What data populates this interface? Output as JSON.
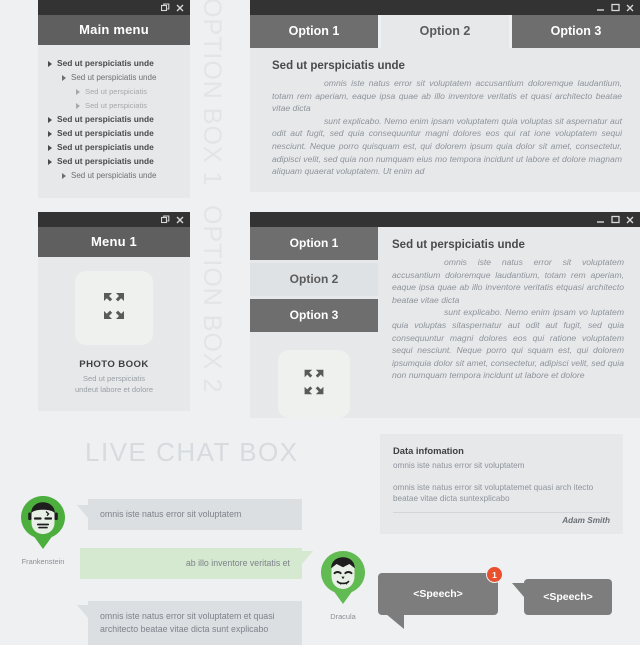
{
  "watermarks": {
    "option_box_1": "OPTION BOX 1",
    "option_box_2": "OPTION BOX 2"
  },
  "main_menu_window": {
    "title": "Main menu",
    "controls": {
      "restore": "restore-icon",
      "close": "close-icon"
    },
    "tree_items": [
      {
        "label": "Sed ut perspiciatis unde",
        "level": 0
      },
      {
        "label": "Sed ut perspiciatis unde",
        "level": 1
      },
      {
        "label": "Sed ut perspiciatis",
        "level": 2
      },
      {
        "label": "Sed ut perspiciatis",
        "level": 2
      },
      {
        "label": "Sed ut perspiciatis unde",
        "level": 0
      },
      {
        "label": "Sed ut perspiciatis unde",
        "level": 0
      },
      {
        "label": "Sed ut perspiciatis unde",
        "level": 0
      },
      {
        "label": "Sed ut perspiciatis unde",
        "level": 0
      },
      {
        "label": "Sed ut perspiciatis unde",
        "level": 1
      }
    ]
  },
  "tabs_window": {
    "controls": {
      "minimize": "minimize-icon",
      "maximize": "maximize-icon",
      "close": "close-icon"
    },
    "tabs": [
      {
        "label": "Option 1",
        "active": false
      },
      {
        "label": "Option 2",
        "active": true
      },
      {
        "label": "Option 3",
        "active": false
      }
    ],
    "content": {
      "heading": "Sed ut perspiciatis unde",
      "paragraph_1": "omnis iste natus error sit voluptatem accusantium doloremque laudantium, totam rem aperiam, eaque ipsa quae ab illo inventore veritatis et quasi architecto beatae vitae dicta",
      "paragraph_2": "sunt explicabo. Nemo enim ipsam voluptatem quia voluptas sit aspernatur aut odit aut fugit, sed quia consequuntur magni dolores eos qui rat ione voluptatem sequi nesciunt. Neque porro quisquam est, qui dolorem ipsum quia dolor sit amet, consectetur, adipisci velit, sed quia non numquam eius mo tempora incidunt ut labore et dolore magnam aliquam quaerat voluptatem. Ut enim ad"
    }
  },
  "photobook_window": {
    "title": "Menu 1",
    "controls": {
      "restore": "restore-icon",
      "close": "close-icon"
    },
    "thumb_icon": "expand-arrows-icon",
    "caption_title": "PHOTO BOOK",
    "caption_line_1": "Sed ut perspiciatis",
    "caption_line_2": "undeut labore et dolore"
  },
  "split_window": {
    "controls": {
      "minimize": "minimize-icon",
      "maximize": "maximize-icon",
      "close": "close-icon"
    },
    "options": [
      {
        "label": "Option 1",
        "active": false
      },
      {
        "label": "Option 2",
        "active": true
      },
      {
        "label": "Option 3",
        "active": false
      }
    ],
    "thumb_icon": "expand-arrows-icon",
    "content": {
      "heading": "Sed ut perspiciatis unde",
      "paragraph_1": "omnis iste natus error sit voluptatem accusantium doloremque laudantium, totam rem aperiam, eaque ipsa quae ab illo inventore veritatis etquasi architecto beatae vitae dicta",
      "paragraph_2": "sunt explicabo. Nemo enim ipsam vo luptatem quia voluptas sitaspernatur aut odit aut fugit, sed quia consequuntur magni dolores eos qui ratione voluptatem sequi nesciunt. Neque porro qui squam est, qui dolorem ipsumquia dolor sit amet, consectetur, adipisci velit, sed quia non numquam tempora incidunt ut labore et dolore"
    }
  },
  "live_chat": {
    "title": "LIVE CHAT BOX",
    "participants": [
      {
        "name": "Frankenstein",
        "avatar_icon": "frankenstein-avatar-icon"
      },
      {
        "name": "Dracula",
        "avatar_icon": "dracula-avatar-icon"
      }
    ],
    "messages": [
      {
        "text": "omnis iste natus error sit voluptatem",
        "side": "left",
        "color": "grey"
      },
      {
        "text": "ab illo inventore veritatis et",
        "side": "right",
        "color": "green"
      },
      {
        "text": "omnis iste natus error sit voluptatem et quasi architecto beatae vitae dicta sunt explicabo",
        "side": "left",
        "color": "grey"
      }
    ]
  },
  "data_info_card": {
    "title": "Data infomation",
    "line_1": "omnis iste natus error sit voluptatem",
    "line_2": "omnis iste natus error sit voluptatemet quasi arch itecto beatae vitae dicta suntexplicabo",
    "author": "Adam Smith"
  },
  "speech_bubbles": {
    "left_label": "<Speech>",
    "right_label": "<Speech>",
    "badge_count": "1"
  },
  "colors": {
    "page_background": "#eef0f2",
    "titlebar": "#333333",
    "menubar": "#5f5f5f",
    "tab_inactive": "#6e6e6e",
    "tab_active": "#e6e8ea",
    "panel_body": "#e6e8ea",
    "bubble_grey": "#dcdfe2",
    "bubble_green": "#d5e8d0",
    "avatar_green": "#4caf3d",
    "badge_red": "#e8502e",
    "speech_grey": "#7d7d7d",
    "watermark": "#e2e5e8"
  }
}
